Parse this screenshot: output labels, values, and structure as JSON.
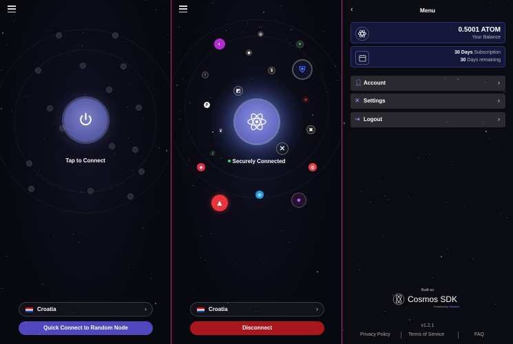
{
  "left_panel": {
    "tap_label": "Tap to Connect",
    "country": "Croatia",
    "quick_connect_label": "Quick Connect to Random Node",
    "accent": "#5148c0"
  },
  "middle_panel": {
    "status_label": "Securely Connected",
    "country": "Croatia",
    "disconnect_label": "Disconnect",
    "accent": "#a8161e",
    "status_color": "#3dd47a"
  },
  "menu": {
    "title": "Menu",
    "balance": {
      "amount": "0.5001 ATOM",
      "label": "Your Balance"
    },
    "subscription": {
      "line1_bold": "30 Days",
      "line1_rest": " Subscription",
      "line2_bold": "30",
      "line2_rest": " Days remaining"
    },
    "items": [
      {
        "label": "Account",
        "icon": "user-icon"
      },
      {
        "label": "Settings",
        "icon": "tools-icon"
      },
      {
        "label": "Logout",
        "icon": "logout-icon"
      }
    ],
    "built_on": "Built on",
    "sdk_name": "Cosmos SDK",
    "powered_by": "Powered by",
    "powered_name": "Sentinel",
    "version": "v1.2.1",
    "footer": [
      "Privacy Policy",
      "Terms of Service",
      "FAQ"
    ]
  }
}
